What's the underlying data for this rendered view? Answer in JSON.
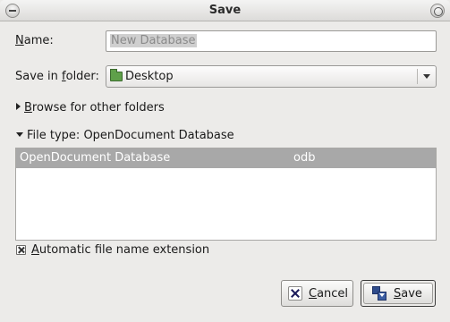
{
  "window": {
    "title": "Save"
  },
  "name_field": {
    "label": "Name:",
    "value": "New Database"
  },
  "folder_field": {
    "label": "Save in folder:",
    "value": "Desktop",
    "icon": "folder-icon"
  },
  "browse_expander": {
    "label": "Browse for other folders",
    "expanded": false
  },
  "filetype_expander": {
    "label": "File type: OpenDocument Database",
    "expanded": true
  },
  "filetype_list": {
    "rows": [
      {
        "name": "OpenDocument Database",
        "ext": "odb",
        "selected": true
      }
    ]
  },
  "auto_extension": {
    "label": "Automatic file name extension",
    "checked": true
  },
  "buttons": {
    "cancel_label": "Cancel",
    "save_label": "Save"
  },
  "colors": {
    "selection_row": "#a8a8a8",
    "window_bg": "#ecebe9",
    "folder_icon": "#5fa04a"
  }
}
